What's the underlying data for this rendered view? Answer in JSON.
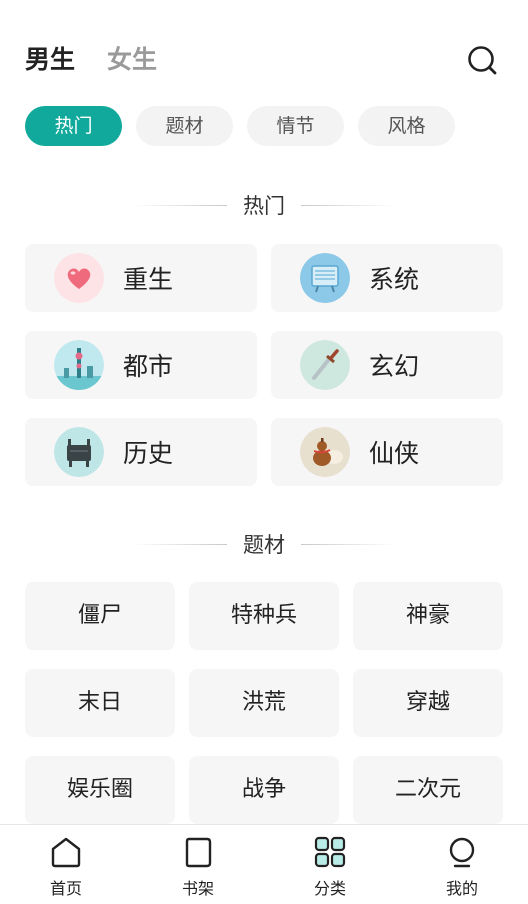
{
  "header": {
    "tabs": [
      {
        "label": "男生",
        "active": true
      },
      {
        "label": "女生",
        "active": false
      }
    ],
    "search_icon": "search-icon"
  },
  "pills": [
    {
      "label": "热门",
      "active": true
    },
    {
      "label": "题材",
      "active": false
    },
    {
      "label": "情节",
      "active": false
    },
    {
      "label": "风格",
      "active": false
    }
  ],
  "hot_section": {
    "title": "热门",
    "items": [
      {
        "label": "重生",
        "icon": "heart-icon"
      },
      {
        "label": "系统",
        "icon": "screen-icon"
      },
      {
        "label": "都市",
        "icon": "city-tower-icon"
      },
      {
        "label": "玄幻",
        "icon": "sword-icon"
      },
      {
        "label": "历史",
        "icon": "bronze-ding-icon"
      },
      {
        "label": "仙侠",
        "icon": "gourd-icon"
      }
    ]
  },
  "theme_section": {
    "title": "题材",
    "items": [
      "僵尸",
      "特种兵",
      "神豪",
      "末日",
      "洪荒",
      "穿越",
      "娱乐圈",
      "战争",
      "二次元"
    ]
  },
  "bottom_nav": {
    "items": [
      {
        "label": "首页",
        "icon": "home-icon",
        "active": false
      },
      {
        "label": "书架",
        "icon": "bookshelf-icon",
        "active": false
      },
      {
        "label": "分类",
        "icon": "category-grid-icon",
        "active": true
      },
      {
        "label": "我的",
        "icon": "profile-icon",
        "active": false
      }
    ]
  },
  "colors": {
    "accent": "#10a99b",
    "pill_bg": "#f3f3f3",
    "card_bg": "#f6f6f6"
  }
}
